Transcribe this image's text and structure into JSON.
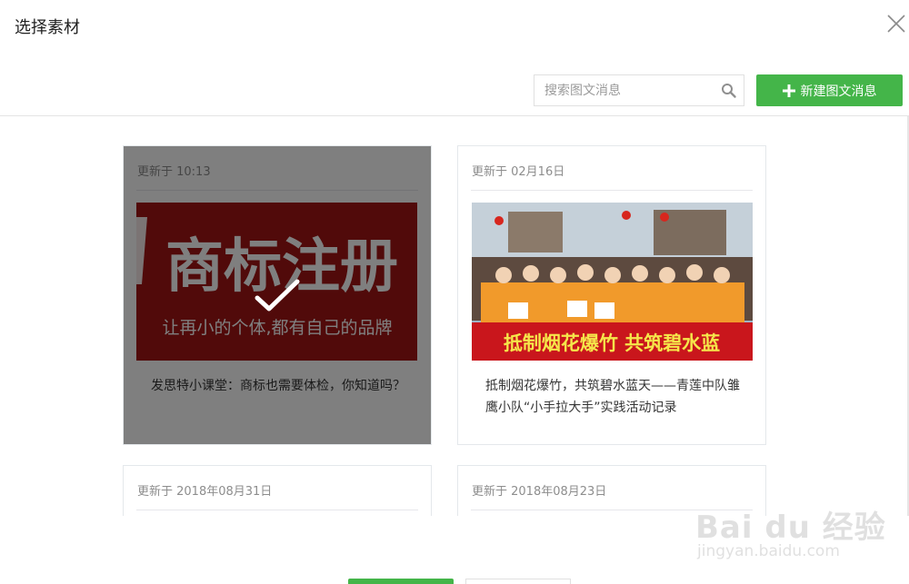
{
  "dialog": {
    "title": "选择素材"
  },
  "toolbar": {
    "search_placeholder": "搜索图文消息",
    "new_button_label": "新建图文消息"
  },
  "cards": [
    {
      "date": "更新于 10:13",
      "cover_heading": "商标注册",
      "cover_slogan": "让再小的个体,都有自己的品牌",
      "title": "发思特小课堂：商标也需要体检，你知道吗？",
      "selected": true
    },
    {
      "date": "更新于 02月16日",
      "cover_banner": "抵制烟花爆竹 共筑碧水蓝",
      "title": "抵制烟花爆竹，共筑碧水蓝天——青莲中队雏鹰小队“小手拉大手”实践活动记录",
      "selected": false
    },
    {
      "date": "更新于 2018年08月31日"
    },
    {
      "date": "更新于 2018年08月23日"
    }
  ],
  "watermark": {
    "logo": "Bai du 经验",
    "url": "jingyan.baidu.com"
  },
  "colors": {
    "accent": "#44b549",
    "card_border": "#e4e8eb",
    "cover_red": "#a31515"
  }
}
